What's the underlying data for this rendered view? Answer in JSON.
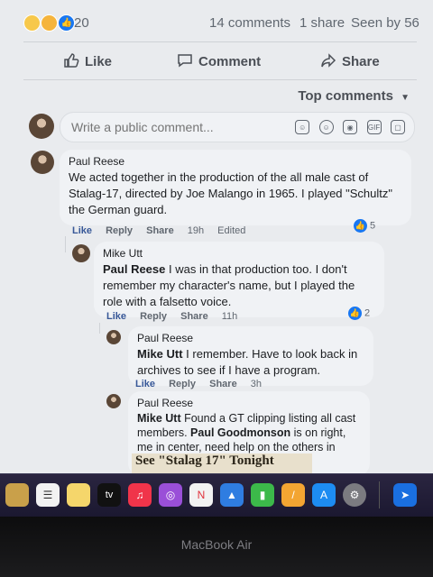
{
  "stats": {
    "reaction_count": "20",
    "comments": "14 comments",
    "shares": "1 share",
    "seen": "Seen by 56"
  },
  "actions": {
    "like": "Like",
    "comment": "Comment",
    "share": "Share"
  },
  "sort_label": "Top comments",
  "composer": {
    "placeholder": "Write a public comment..."
  },
  "comments": [
    {
      "author": "Paul Reese",
      "text": "We acted together in the production of the all male cast of Stalag-17, directed by Joe Malango in 1965. I played \"Schultz\" the German guard.",
      "like": "Like",
      "reply": "Reply",
      "share": "Share",
      "time": "19h",
      "edited": "Edited",
      "reactions": "5"
    },
    {
      "author": "Mike Utt",
      "mention": "Paul Reese",
      "text": " I was in that production too. I don't remember my character's name, but I played the role with a falsetto voice.",
      "like": "Like",
      "reply": "Reply",
      "share": "Share",
      "time": "11h",
      "reactions": "2"
    },
    {
      "author": "Paul Reese",
      "mention": "Mike Utt",
      "text": " I remember. Have to look back in archives to see if I have a program.",
      "like": "Like",
      "reply": "Reply",
      "share": "Share",
      "time": "3h"
    },
    {
      "author": "Paul Reese",
      "mention": "Mike Utt",
      "text_a": " Found a GT clipping listing all cast members. ",
      "mention2": "Paul Goodmonson",
      "text_b": " is on right, me in center, need help on the others in picture."
    }
  ],
  "clipping_title": "See \"Stalag 17\" Tonight",
  "dock_labels": {
    "tv": "tv"
  },
  "laptop_brand": "MacBook Air",
  "colors": {
    "like_blue": "#1877f2",
    "link_blue": "#385898",
    "bubble": "#f0f2f5"
  }
}
